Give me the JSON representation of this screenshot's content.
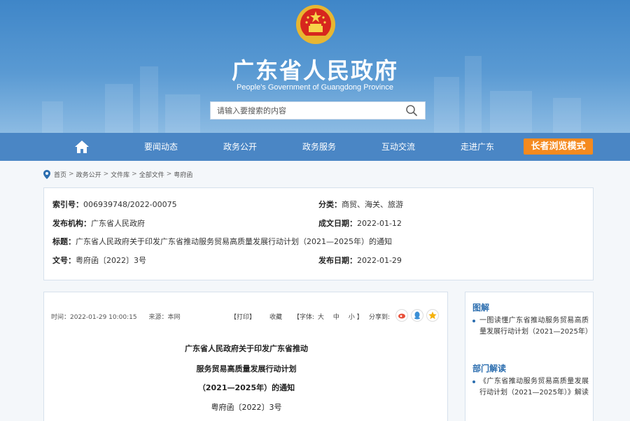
{
  "header": {
    "title": "广东省人民政府",
    "subtitle": "People's Government of Guangdong Province",
    "emblem_icon": "national-emblem-icon",
    "search_placeholder": "请输入要搜索的内容"
  },
  "nav": {
    "items": [
      "要闻动态",
      "政务公开",
      "政务服务",
      "互动交流",
      "走进广东"
    ],
    "elder_mode": "长者浏览模式"
  },
  "breadcrumb": [
    "首页",
    "政务公开",
    "文件库",
    "全部文件",
    "粤府函"
  ],
  "meta": {
    "index_label": "索引号：",
    "index_value": "006939748/2022-00075",
    "category_label": "分类：",
    "category_value": "商贸、海关、旅游",
    "publisher_label": "发布机构：",
    "publisher_value": "广东省人民政府",
    "written_label": "成文日期：",
    "written_value": "2022-01-12",
    "title_label": "标题：",
    "title_value": "广东省人民政府关于印发广东省推动服务贸易高质量发展行动计划（2021—2025年）的通知",
    "docno_label": "文号：",
    "docno_value": "粤府函〔2022〕3号",
    "pubdate_label": "发布日期：",
    "pubdate_value": "2022-01-29"
  },
  "article": {
    "time": "时间：2022-01-29 10:00:15",
    "source": "来源：本网",
    "print": "【打印】",
    "favorite": "收藏",
    "font_label": "【字体:",
    "font_large": "大",
    "font_medium": "中",
    "font_small": "小",
    "font_close": "】",
    "share_label": "分享到:",
    "heading_lines": [
      "广东省人民政府关于印发广东省推动",
      "服务贸易高质量发展行动计划",
      "（2021—2025年）的通知"
    ],
    "doc_number": "粤府函〔2022〕3号"
  },
  "sidebar": {
    "section1_title": "图解",
    "section1_item": "一图读懂广东省推动服务贸易高质量发展行动计划（2021—2025年）",
    "section2_title": "部门解读",
    "section2_item": "《广东省推动服务贸易高质量发展行动计划（2021—2025年）》解读"
  },
  "colors": {
    "nav_bg": "#4a86c5",
    "elder_btn": "#f58a1f",
    "accent": "#2c6eaf"
  }
}
